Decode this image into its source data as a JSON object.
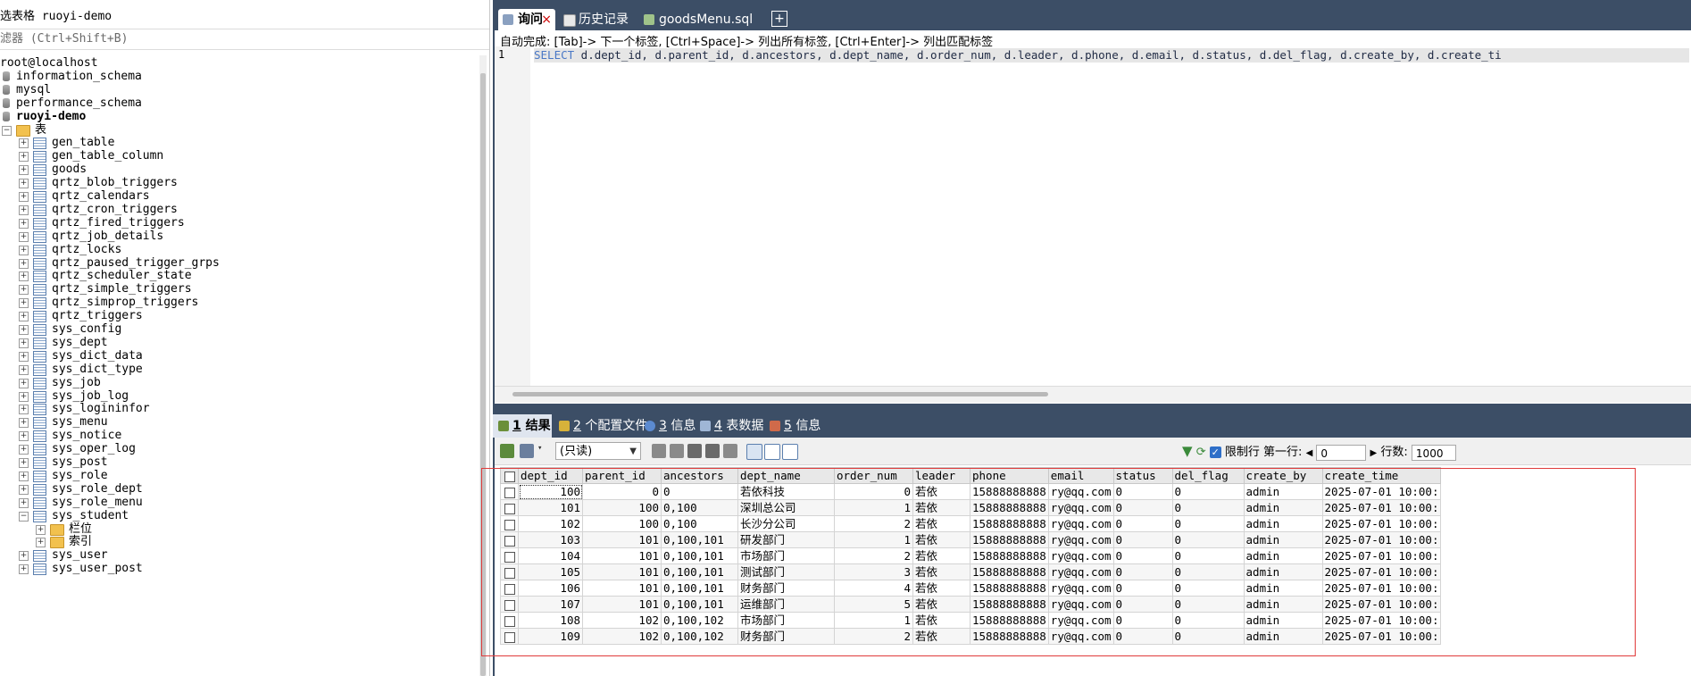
{
  "left_panel": {
    "db_select_label": "选表格 ruoyi-demo",
    "filter_placeholder": "滤器 (Ctrl+Shift+B)",
    "connection": "root@localhost",
    "databases": [
      "information_schema",
      "mysql",
      "performance_schema",
      "ruoyi-demo"
    ],
    "tables_folder": "表",
    "tables": [
      "gen_table",
      "gen_table_column",
      "goods",
      "qrtz_blob_triggers",
      "qrtz_calendars",
      "qrtz_cron_triggers",
      "qrtz_fired_triggers",
      "qrtz_job_details",
      "qrtz_locks",
      "qrtz_paused_trigger_grps",
      "qrtz_scheduler_state",
      "qrtz_simple_triggers",
      "qrtz_simprop_triggers",
      "qrtz_triggers",
      "sys_config",
      "sys_dept",
      "sys_dict_data",
      "sys_dict_type",
      "sys_job",
      "sys_job_log",
      "sys_logininfor",
      "sys_menu",
      "sys_notice",
      "sys_oper_log",
      "sys_post",
      "sys_role",
      "sys_role_dept",
      "sys_role_menu",
      "sys_student"
    ],
    "student_children": [
      "栏位",
      "索引"
    ],
    "after_student": [
      "sys_user",
      "sys_user_post"
    ]
  },
  "editor": {
    "tabs": [
      {
        "label": "询问",
        "close": "×",
        "active": true
      },
      {
        "label": "历史记录",
        "active": false
      },
      {
        "label": "goodsMenu.sql",
        "active": false
      }
    ],
    "add_tab": "+",
    "autocomplete_hint": "自动完成: [Tab]-> 下一个标签, [Ctrl+Space]-> 列出所有标签, [Ctrl+Enter]-> 列出匹配标签",
    "line_number": "1",
    "sql_keyword": "SELECT",
    "sql_rest": " d.dept_id, d.parent_id, d.ancestors, d.dept_name, d.order_num, d.leader, d.phone, d.email, d.status, d.del_flag, d.create_by, d.create_ti"
  },
  "result_tabs": [
    {
      "num": "1",
      "label": "结果",
      "active": true
    },
    {
      "num": "2",
      "label": "个配置文件",
      "active": false
    },
    {
      "num": "3",
      "label": "信息",
      "active": false
    },
    {
      "num": "4",
      "label": "表数据",
      "active": false
    },
    {
      "num": "5",
      "label": "信息",
      "active": false
    }
  ],
  "result_toolbar": {
    "mode": "(只读)",
    "limit_label": "限制行",
    "first_row_label": "第一行:",
    "first_row_value": "0",
    "rows_label": "行数:",
    "rows_value": "1000"
  },
  "grid": {
    "columns": [
      "dept_id",
      "parent_id",
      "ancestors",
      "dept_name",
      "order_num",
      "leader",
      "phone",
      "email",
      "status",
      "del_flag",
      "create_by",
      "create_time"
    ],
    "rows": [
      [
        "100",
        "0",
        "0",
        "若依科技",
        "0",
        "若依",
        "15888888888",
        "ry@qq.com",
        "0",
        "0",
        "admin",
        "2025-07-01 10:00:"
      ],
      [
        "101",
        "100",
        "0,100",
        "深圳总公司",
        "1",
        "若依",
        "15888888888",
        "ry@qq.com",
        "0",
        "0",
        "admin",
        "2025-07-01 10:00:"
      ],
      [
        "102",
        "100",
        "0,100",
        "长沙分公司",
        "2",
        "若依",
        "15888888888",
        "ry@qq.com",
        "0",
        "0",
        "admin",
        "2025-07-01 10:00:"
      ],
      [
        "103",
        "101",
        "0,100,101",
        "研发部门",
        "1",
        "若依",
        "15888888888",
        "ry@qq.com",
        "0",
        "0",
        "admin",
        "2025-07-01 10:00:"
      ],
      [
        "104",
        "101",
        "0,100,101",
        "市场部门",
        "2",
        "若依",
        "15888888888",
        "ry@qq.com",
        "0",
        "0",
        "admin",
        "2025-07-01 10:00:"
      ],
      [
        "105",
        "101",
        "0,100,101",
        "测试部门",
        "3",
        "若依",
        "15888888888",
        "ry@qq.com",
        "0",
        "0",
        "admin",
        "2025-07-01 10:00:"
      ],
      [
        "106",
        "101",
        "0,100,101",
        "财务部门",
        "4",
        "若依",
        "15888888888",
        "ry@qq.com",
        "0",
        "0",
        "admin",
        "2025-07-01 10:00:"
      ],
      [
        "107",
        "101",
        "0,100,101",
        "运维部门",
        "5",
        "若依",
        "15888888888",
        "ry@qq.com",
        "0",
        "0",
        "admin",
        "2025-07-01 10:00:"
      ],
      [
        "108",
        "102",
        "0,100,102",
        "市场部门",
        "1",
        "若依",
        "15888888888",
        "ry@qq.com",
        "0",
        "0",
        "admin",
        "2025-07-01 10:00:"
      ],
      [
        "109",
        "102",
        "0,100,102",
        "财务部门",
        "2",
        "若依",
        "15888888888",
        "ry@qq.com",
        "0",
        "0",
        "admin",
        "2025-07-01 10:00:"
      ]
    ]
  },
  "colors": {
    "header_bar": "#3c4e66",
    "highlight_box": "#e03b3b"
  }
}
